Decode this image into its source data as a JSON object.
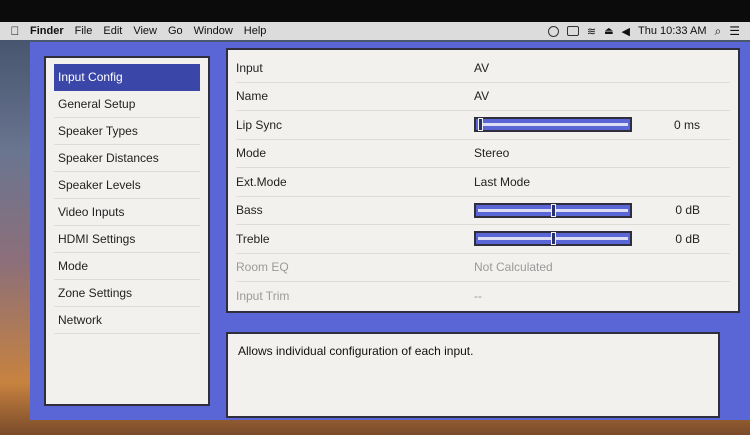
{
  "menubar": {
    "items": [
      "Finder",
      "File",
      "Edit",
      "View",
      "Go",
      "Window",
      "Help"
    ],
    "clock": "Thu 10:33 AM"
  },
  "sidebar": {
    "items": [
      {
        "label": "Input Config",
        "active": true
      },
      {
        "label": "General Setup"
      },
      {
        "label": "Speaker Types"
      },
      {
        "label": "Speaker Distances"
      },
      {
        "label": "Speaker Levels"
      },
      {
        "label": "Video Inputs"
      },
      {
        "label": "HDMI Settings"
      },
      {
        "label": "Mode"
      },
      {
        "label": "Zone Settings"
      },
      {
        "label": "Network"
      }
    ]
  },
  "settings": {
    "input": {
      "label": "Input",
      "value": "AV"
    },
    "name": {
      "label": "Name",
      "value": "AV"
    },
    "lip_sync": {
      "label": "Lip Sync",
      "value": "0 ms",
      "level": 0.0
    },
    "mode": {
      "label": "Mode",
      "value": "Stereo"
    },
    "ext_mode": {
      "label": "Ext.Mode",
      "value": "Last Mode"
    },
    "bass": {
      "label": "Bass",
      "value": "0 dB",
      "level": 0.5
    },
    "treble": {
      "label": "Treble",
      "value": "0 dB",
      "level": 0.5
    },
    "room_eq": {
      "label": "Room EQ",
      "value": "Not Calculated"
    },
    "input_trim": {
      "label": "Input Trim",
      "value": "--"
    }
  },
  "description": "Allows individual configuration of each input.",
  "colors": {
    "frame_blue": "#5b66d6",
    "selection_blue": "#3a47a8",
    "panel_bg": "#f2f1ee"
  }
}
